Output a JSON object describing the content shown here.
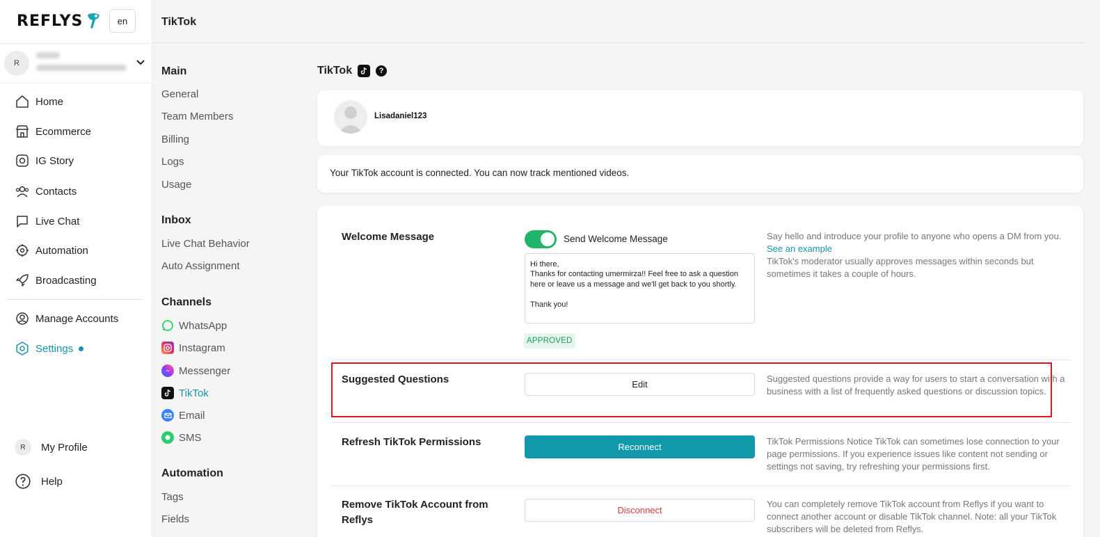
{
  "brand": {
    "logo_text": "REFLYS",
    "language": "en",
    "accent_color": "#1595a8"
  },
  "account": {
    "avatar_initial": "R"
  },
  "nav": {
    "items": [
      {
        "label": "Home",
        "icon": "home-icon"
      },
      {
        "label": "Ecommerce",
        "icon": "store-icon"
      },
      {
        "label": "IG Story",
        "icon": "ig-story-icon"
      },
      {
        "label": "Contacts",
        "icon": "contacts-icon"
      },
      {
        "label": "Live Chat",
        "icon": "chat-icon"
      },
      {
        "label": "Automation",
        "icon": "automation-icon"
      },
      {
        "label": "Broadcasting",
        "icon": "rocket-icon"
      }
    ],
    "manage_accounts": "Manage Accounts",
    "settings": "Settings",
    "my_profile": "My Profile",
    "my_profile_initial": "R",
    "help": "Help"
  },
  "header": {
    "title": "TikTok"
  },
  "settings_nav": {
    "main": {
      "heading": "Main",
      "items": [
        "General",
        "Team Members",
        "Billing",
        "Logs",
        "Usage"
      ]
    },
    "inbox": {
      "heading": "Inbox",
      "items": [
        "Live Chat Behavior",
        "Auto Assignment"
      ]
    },
    "channels": {
      "heading": "Channels",
      "items": [
        "WhatsApp",
        "Instagram",
        "Messenger",
        "TikTok",
        "Email",
        "SMS"
      ]
    },
    "automation": {
      "heading": "Automation",
      "items": [
        "Tags",
        "Fields"
      ]
    }
  },
  "content": {
    "title": "TikTok",
    "help_symbol": "?",
    "username": "Lisadaniel123",
    "connected_notice": "Your TikTok account is connected. You can now track mentioned videos.",
    "welcome": {
      "title": "Welcome Message",
      "toggle_label": "Send Welcome Message",
      "toggle_on": true,
      "message": "Hi there,\nThanks for contacting umermirza!! Feel free to ask a question here or leave us a message and we'll get back to you shortly.\n\nThank you!",
      "status": "APPROVED",
      "desc_1": "Say hello and introduce your profile to anyone who opens a DM from you.",
      "desc_link": "See an example",
      "desc_2": "TikTok's moderator usually approves messages within seconds but sometimes it takes a couple of hours."
    },
    "suggested": {
      "title": "Suggested Questions",
      "button": "Edit",
      "desc": "Suggested questions provide a way for users to start a conversation with a business with a list of frequently asked questions or discussion topics."
    },
    "refresh": {
      "title": "Refresh TikTok Permissions",
      "button": "Reconnect",
      "desc": "TikTok Permissions Notice TikTok can sometimes lose connection to your page permissions. If you experience issues like content not sending or settings not saving, try refreshing your permissions first."
    },
    "remove": {
      "title": "Remove TikTok Account from Reflys",
      "button": "Disconnect",
      "desc": "You can completely remove TikTok account from Reflys if you want to connect another account or disable TikTok channel. Note: all your TikTok subscribers will be deleted from Reflys."
    }
  }
}
